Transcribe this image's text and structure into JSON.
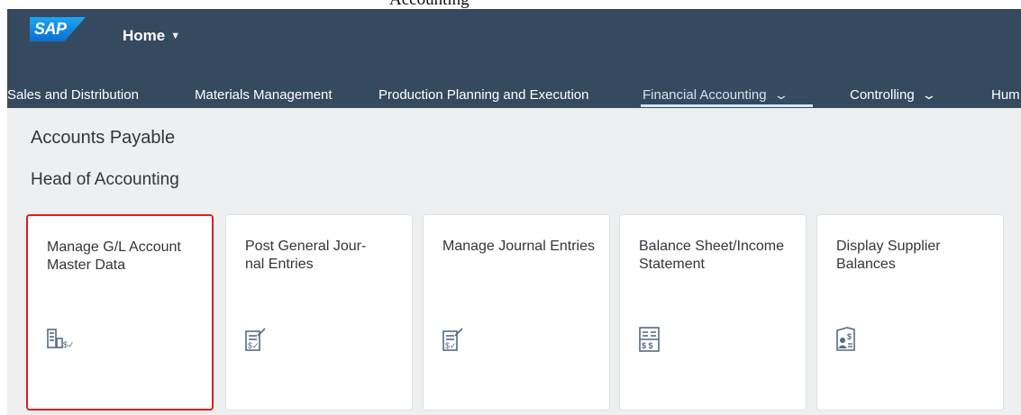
{
  "shell": {
    "logo_text": "SAP",
    "home_label": "Home",
    "cut_off_text": "Accounting"
  },
  "tabs": [
    {
      "label": "Sales and Distribution"
    },
    {
      "label": "Materials Management"
    },
    {
      "label": "Production Planning and Execution"
    },
    {
      "label": "Financial Accounting",
      "active": true,
      "has_chevron": true
    },
    {
      "label": "Controlling",
      "has_chevron": true
    },
    {
      "label": "Hum"
    }
  ],
  "section": {
    "title": "Accounts Payable",
    "group_title": "Head of Accounting"
  },
  "tiles": [
    {
      "title": "Manage G/L Account Master Data",
      "icon": "gl-account-master-data-icon",
      "selected": true
    },
    {
      "title": "Post General Jour-\nnal Entries",
      "icon": "journal-entry-post-icon"
    },
    {
      "title": "Manage Journal Entries",
      "icon": "journal-entry-manage-icon"
    },
    {
      "title": "Balance Sheet/Income Statement",
      "icon": "balance-sheet-icon"
    },
    {
      "title": "Display Supplier Balances",
      "icon": "supplier-balance-icon"
    }
  ],
  "colors": {
    "shell_bg": "#354a5f",
    "content_bg": "#edeff0",
    "icon": "#556b82",
    "selection": "#e21b1b"
  }
}
